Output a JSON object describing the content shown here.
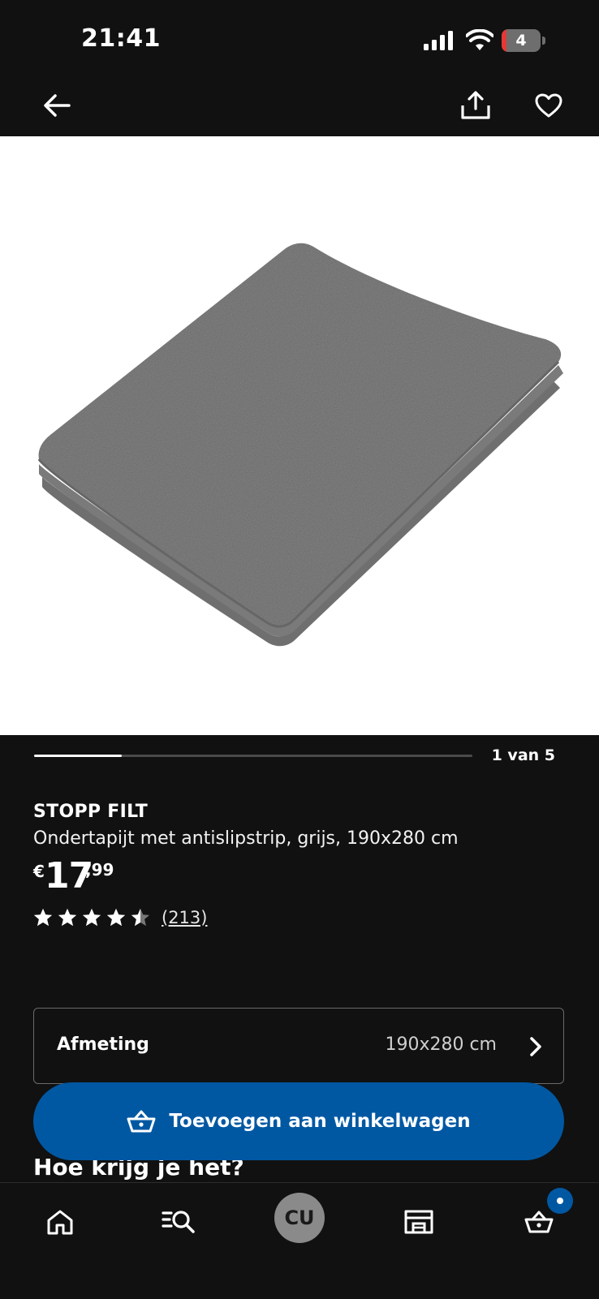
{
  "status_bar": {
    "time": "21:41",
    "battery_level": "4"
  },
  "product": {
    "name": "STOPP FILT",
    "description": "Ondertapijt met antislipstrip, grijs, 190x280 cm",
    "price": {
      "currency": "€",
      "whole": "17",
      "cents": ",99"
    },
    "rating": {
      "stars": 4.5,
      "max": 5,
      "review_count": "(213)"
    }
  },
  "gallery": {
    "counter": "1 van 5",
    "current": 1,
    "total": 5
  },
  "size_selector": {
    "label": "Afmeting",
    "value": "190x280 cm"
  },
  "add_to_cart": {
    "label": "Toevoegen aan winkelwagen"
  },
  "delivery": {
    "heading": "Hoe krijg je het?"
  },
  "bottom_nav": {
    "items": [
      "home-icon",
      "search-icon",
      "profile-avatar",
      "store-icon",
      "cart-icon"
    ],
    "avatar_initials": "CU"
  },
  "colors": {
    "background": "#111111",
    "accent_blue": "#0058a3",
    "text": "#ffffff"
  }
}
